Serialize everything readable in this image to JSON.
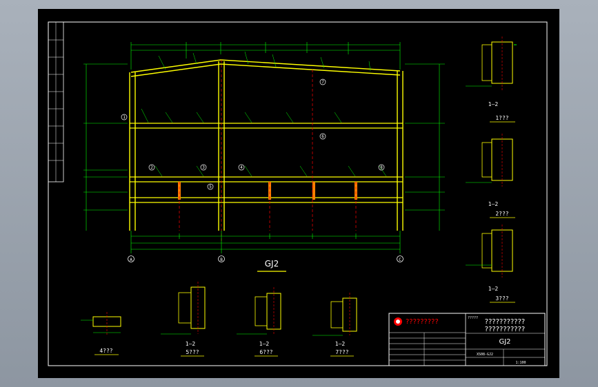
{
  "drawing": {
    "main_title": "GJ2",
    "axis_labels": [
      "A",
      "B",
      "C"
    ],
    "member_tags": [
      "1",
      "2",
      "3",
      "4",
      "5",
      "6",
      "7",
      "8"
    ],
    "details": {
      "d1": {
        "section": "1—2",
        "caption": "1???"
      },
      "d2": {
        "section": "1—2",
        "caption": "2???"
      },
      "d3": {
        "section": "1—2",
        "caption": "3???"
      },
      "d4": {
        "caption": "4???"
      },
      "d5": {
        "section": "1—2",
        "caption": "5???"
      },
      "d6": {
        "section": "1—2",
        "caption": "6???"
      },
      "d7": {
        "section": "1—2",
        "caption": "7???"
      }
    }
  },
  "title_block": {
    "company": "?????????",
    "project_label": "?????",
    "project_name_line1": "???????????",
    "project_name_line2": "???????????",
    "drawing_name": "GJ2",
    "drawing_no": "XS08-GJ2",
    "scale_label": "1:100"
  },
  "colors": {
    "background": "#000000",
    "frame": "#ffffff",
    "steel": "#ffff00",
    "annotation": "#00ff00",
    "centerline": "#ff0000",
    "text": "#ffffff"
  }
}
